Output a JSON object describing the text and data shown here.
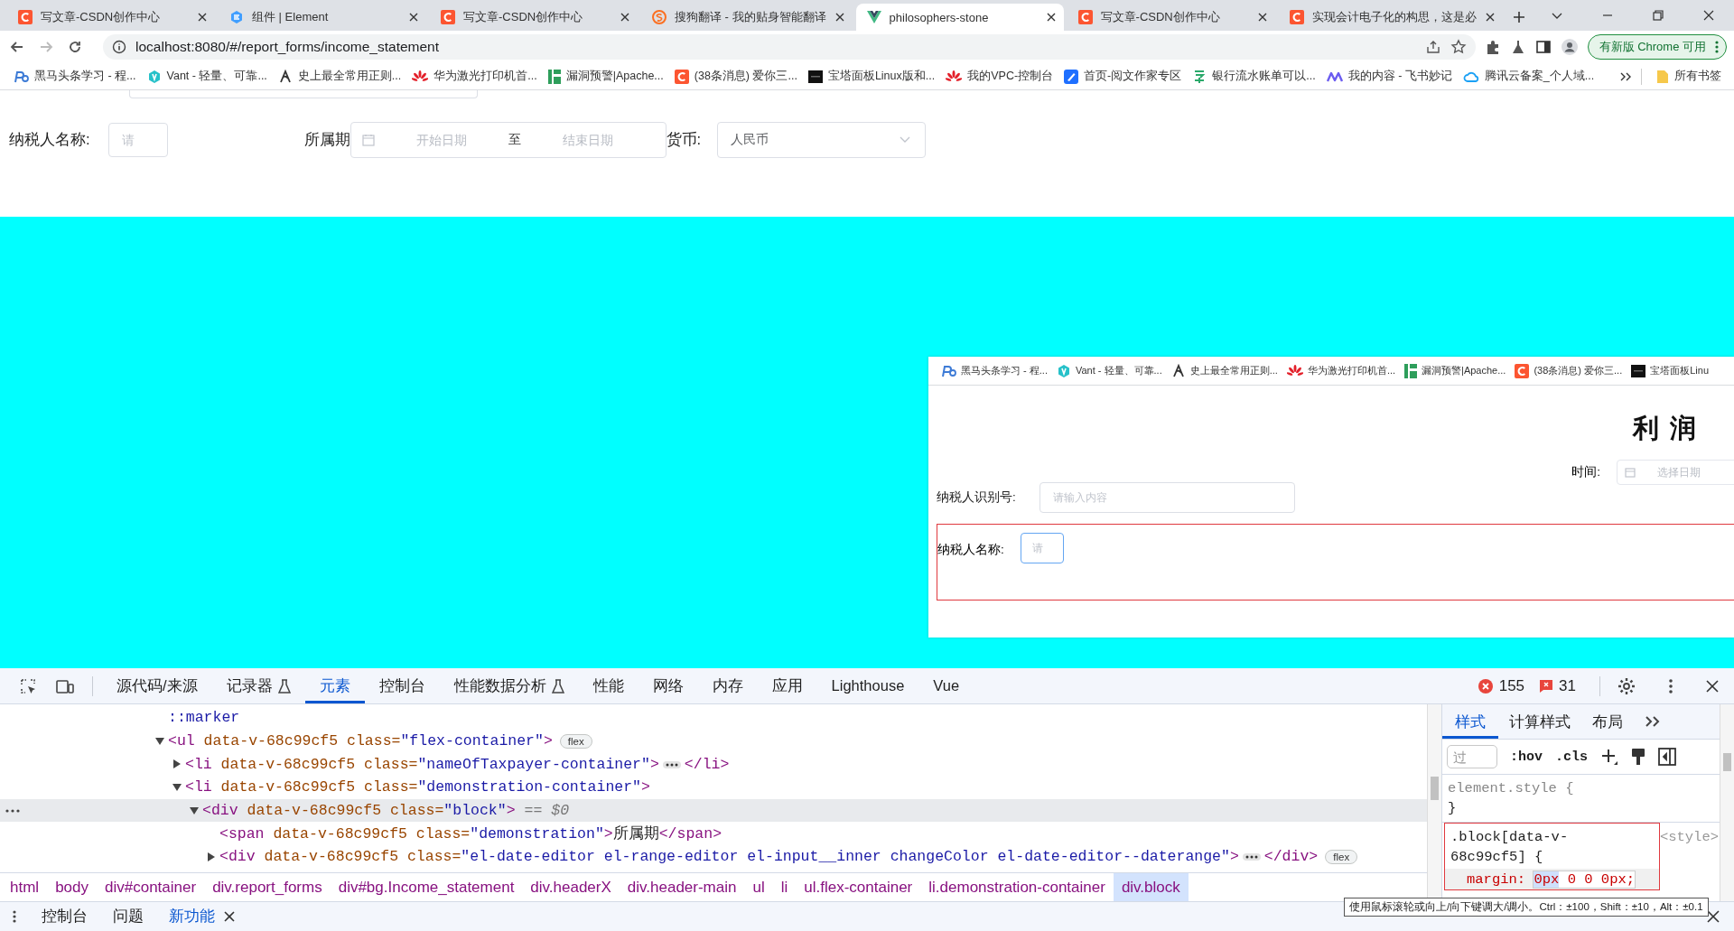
{
  "browser": {
    "tabs": [
      {
        "title": "写文章-CSDN创作中心",
        "kind": "csdn",
        "selected": false
      },
      {
        "title": "组件 | Element",
        "kind": "element",
        "selected": false
      },
      {
        "title": "写文章-CSDN创作中心",
        "kind": "csdn",
        "selected": false
      },
      {
        "title": "搜狗翻译 - 我的贴身智能翻译",
        "kind": "sogou",
        "selected": false
      },
      {
        "title": "philosophers-stone",
        "kind": "vue",
        "selected": true
      },
      {
        "title": "写文章-CSDN创作中心",
        "kind": "csdn",
        "selected": false
      },
      {
        "title": "实现会计电子化的构思，这是必",
        "kind": "csdn",
        "selected": false
      }
    ],
    "address": "localhost:8080/#/report_forms/income_statement",
    "update_button": "有新版 Chrome 可用",
    "bookmarks": [
      {
        "label": "黑马头条学习 - 程...",
        "kind": "ps"
      },
      {
        "label": "Vant - 轻量、可靠...",
        "kind": "vant"
      },
      {
        "label": "史上最全常用正则...",
        "kind": "regex"
      },
      {
        "label": "华为激光打印机首...",
        "kind": "huawei"
      },
      {
        "label": "漏洞预警|Apache...",
        "kind": "bars"
      },
      {
        "label": "(38条消息) 爱你三...",
        "kind": "csdn"
      },
      {
        "label": "宝塔面板Linux版和...",
        "kind": "baota"
      },
      {
        "label": "我的VPC-控制台",
        "kind": "huawei"
      },
      {
        "label": "首页-阅文作家专区",
        "kind": "pen"
      },
      {
        "label": "银行流水账单可以...",
        "kind": "leaf"
      },
      {
        "label": "我的内容 - 飞书妙记",
        "kind": "wave"
      },
      {
        "label": "腾讯云备案_个人域...",
        "kind": "cloud"
      }
    ],
    "all_bookmarks": "所有书签"
  },
  "form": {
    "name_label": "纳税人名称:",
    "name_placeholder": "请",
    "period_label": "所属期",
    "start_placeholder": "开始日期",
    "range_separator": "至",
    "end_placeholder": "结束日期",
    "currency_label": "货币:",
    "currency_value": "人民币"
  },
  "inset": {
    "bookmarks": [
      {
        "label": "黑马头条学习 - 程...",
        "kind": "ps"
      },
      {
        "label": "Vant - 轻量、可靠...",
        "kind": "vant"
      },
      {
        "label": "史上最全常用正则...",
        "kind": "regex"
      },
      {
        "label": "华为激光打印机首...",
        "kind": "huawei"
      },
      {
        "label": "漏洞预警|Apache...",
        "kind": "bars"
      },
      {
        "label": "(38条消息) 爱你三...",
        "kind": "csdn"
      },
      {
        "label": "宝塔面板Linu",
        "kind": "baota"
      }
    ],
    "title": "利 润",
    "time_label": "时间:",
    "date_placeholder": "选择日期",
    "taxpayer_id_label": "纳税人识别号:",
    "taxpayer_id_placeholder": "请输入内容",
    "name_label": "纳税人名称:",
    "name_placeholder": "请"
  },
  "devtools": {
    "tabs": [
      {
        "label": "源代码/来源",
        "selected": false,
        "experimental": false
      },
      {
        "label": "记录器",
        "selected": false,
        "experimental": true
      },
      {
        "label": "元素",
        "selected": true,
        "experimental": false
      },
      {
        "label": "控制台",
        "selected": false,
        "experimental": false
      },
      {
        "label": "性能数据分析",
        "selected": false,
        "experimental": true
      },
      {
        "label": "性能",
        "selected": false,
        "experimental": false
      },
      {
        "label": "网络",
        "selected": false,
        "experimental": false
      },
      {
        "label": "内存",
        "selected": false,
        "experimental": false
      },
      {
        "label": "应用",
        "selected": false,
        "experimental": false
      },
      {
        "label": "Lighthouse",
        "selected": false,
        "experimental": false
      },
      {
        "label": "Vue",
        "selected": false,
        "experimental": false
      }
    ],
    "errors": "155",
    "issues": "31",
    "dom_tree": [
      {
        "kind": "pseudo",
        "label": "::marker",
        "selected": false
      },
      {
        "kind": "element",
        "open_tag": "<ul data-v-68c99cf5 class=\"flex-container\">",
        "badge": "flex",
        "expanded": true,
        "selected": false,
        "children": [
          {
            "kind": "element",
            "open_tag": "<li data-v-68c99cf5 class=\"nameOfTaxpayer-container\">",
            "close_tag": "</li>",
            "expanded": false,
            "selected": false
          },
          {
            "kind": "element",
            "open_tag": "<li data-v-68c99cf5 class=\"demonstration-container\">",
            "expanded": true,
            "selected": false,
            "children": [
              {
                "kind": "element",
                "open_tag": "<div data-v-68c99cf5 class=\"block\">",
                "suffix": "== $0",
                "expanded": true,
                "selected": true,
                "children": [
                  {
                    "kind": "element",
                    "open_tag": "<span data-v-68c99cf5 class=\"demonstration\">",
                    "text": "所属期",
                    "close_tag": "</span>",
                    "selected": false
                  },
                  {
                    "kind": "element",
                    "open_tag": "<div data-v-68c99cf5 class=\"el-date-editor el-range-editor el-input__inner changeColor el-date-editor--daterange\">",
                    "close_tag": "</div>",
                    "badge": "flex",
                    "expanded": false,
                    "selected": false
                  }
                ]
              }
            ]
          }
        ]
      }
    ],
    "breadcrumbs": [
      {
        "label": "html",
        "selected": false
      },
      {
        "label": "body",
        "selected": false
      },
      {
        "label": "div#container",
        "selected": false
      },
      {
        "label": "div.report_forms",
        "selected": false
      },
      {
        "label": "div#bg.Income_statement",
        "selected": false
      },
      {
        "label": "div.headerX",
        "selected": false
      },
      {
        "label": "div.header-main",
        "selected": false
      },
      {
        "label": "ul",
        "selected": false
      },
      {
        "label": "li",
        "selected": false
      },
      {
        "label": "ul.flex-container",
        "selected": false
      },
      {
        "label": "li.demonstration-container",
        "selected": false
      },
      {
        "label": "div.block",
        "selected": true
      }
    ],
    "styles_tabs": [
      {
        "label": "样式",
        "selected": true
      },
      {
        "label": "计算样式",
        "selected": false
      },
      {
        "label": "布局",
        "selected": false
      }
    ],
    "filter_placeholder": "过",
    "hov": ":hov",
    "cls": ".cls",
    "rules": [
      {
        "selector": "element.style {",
        "close": "}",
        "highlighted": false
      },
      {
        "selector": ".block[data-v-68c99cf5] {",
        "source": "<style>",
        "property": "margin:",
        "value": "0px 0 0 0px;",
        "highlighted": true
      }
    ],
    "drawer_tabs": [
      {
        "label": "控制台",
        "selected": false,
        "closable": false
      },
      {
        "label": "问题",
        "selected": false,
        "closable": false
      },
      {
        "label": "新功能",
        "selected": true,
        "closable": true
      }
    ],
    "tooltip": "使用鼠标滚轮或向上/向下键调大/调小。Ctrl：±100，Shift：±10，Alt：±0.1"
  }
}
